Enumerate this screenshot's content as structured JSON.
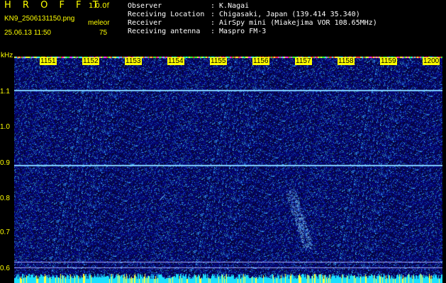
{
  "header": {
    "title": "H R O F F T",
    "version": "1.0.0f",
    "filename": "KN9_2506131150.png",
    "datetime": "25.06.13 11:50",
    "unit_label": "meleor",
    "unit_value": "75"
  },
  "info": [
    {
      "key": "Observer",
      "value": ": K.Nagai"
    },
    {
      "key": "Receiving Location",
      "value": ": Chigasaki, Japan (139.414 35.340)"
    },
    {
      "key": "Receiver",
      "value": ": AirSpy mini (Miakejima VOR 108.65MHz)"
    },
    {
      "key": "Receiving antenna",
      "value": ": Maspro FM-3"
    }
  ],
  "axis": {
    "y_unit": "kHz",
    "y_ticks": [
      "1.1",
      "1.0",
      "0.9",
      "0.8",
      "0.7",
      "0.6"
    ],
    "x_ticks": [
      "1151",
      "1152",
      "1153",
      "1154",
      "1155",
      "1156",
      "1157",
      "1158",
      "1159",
      "1200"
    ]
  },
  "colors": {
    "background": "#000000",
    "header_text": "#ffff00",
    "info_text": "#ffffff",
    "noise_base": "#0a0a8c",
    "line_color": "#7fd0ff",
    "bottom_band": "#19e0ff"
  }
}
